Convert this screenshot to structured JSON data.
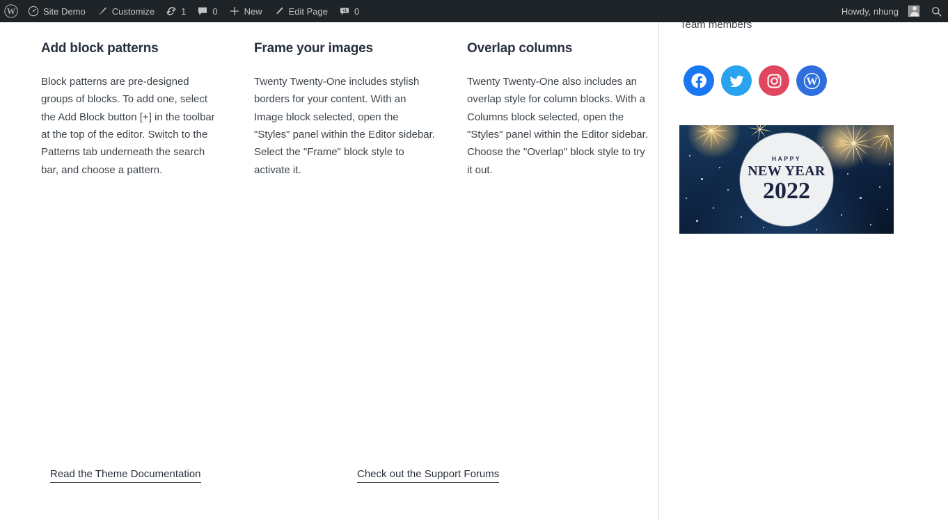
{
  "adminbar": {
    "logo_icon": "wordpress-logo-icon",
    "site": {
      "label": "Site Demo",
      "icon": "dashboard-icon"
    },
    "customize": {
      "label": "Customize",
      "icon": "paintbrush-icon"
    },
    "updates": {
      "count": "1",
      "icon": "updates-icon"
    },
    "comments": {
      "count": "0",
      "icon": "comment-bubble-icon"
    },
    "new": {
      "label": "New",
      "icon": "plus-icon"
    },
    "edit_page": {
      "label": "Edit Page",
      "icon": "pencil-icon"
    },
    "comment_reply": {
      "count": "0",
      "icon": "comment-plus-icon"
    },
    "howdy": "Howdy, nhung",
    "avatar_icon": "user-avatar-icon",
    "search_icon": "search-icon"
  },
  "columns": [
    {
      "heading": "Add block patterns",
      "body": "Block patterns are pre-designed groups of blocks. To add one, select the Add Block button [+] in the toolbar at the top of the editor. Switch to the Patterns tab underneath the search bar, and choose a pattern."
    },
    {
      "heading": "Frame your images",
      "body": "Twenty Twenty-One includes stylish borders for your content. With an Image block selected, open the \"Styles\" panel within the Editor sidebar. Select the \"Frame\" block style to activate it."
    },
    {
      "heading": "Overlap columns",
      "body": "Twenty Twenty-One also includes an overlap style for column blocks. With a Columns block selected, open the \"Styles\" panel within the Editor sidebar. Choose the \"Overlap\" block style to try it out."
    }
  ],
  "bottom_links": [
    {
      "label": "Read the Theme Documentation"
    },
    {
      "label": "Check out the Support Forums"
    }
  ],
  "sidebar": {
    "team_label": "Team members",
    "socials": [
      {
        "name": "facebook",
        "icon": "facebook-icon",
        "color": "#1977f2"
      },
      {
        "name": "twitter",
        "icon": "twitter-icon",
        "color": "#2aa3ef"
      },
      {
        "name": "instagram",
        "icon": "instagram-icon",
        "color": "#e0475f"
      },
      {
        "name": "wordpress",
        "icon": "wordpress-icon",
        "color": "#2f6fdd"
      }
    ],
    "new_year_image": {
      "alt": "Happy New Year 2022 fireworks banner",
      "happy": "HAPPY",
      "new_year": "NEW YEAR",
      "year": "2022",
      "background_color": "#0f2742",
      "text_color": "#1b2340"
    }
  },
  "colors": {
    "adminbar_bg": "#1d2327",
    "adminbar_text": "#c3c4c7",
    "body_text": "#3c434a",
    "heading_text": "#28303d",
    "divider": "#dcd7ca",
    "page_bg": "#ffffff"
  }
}
